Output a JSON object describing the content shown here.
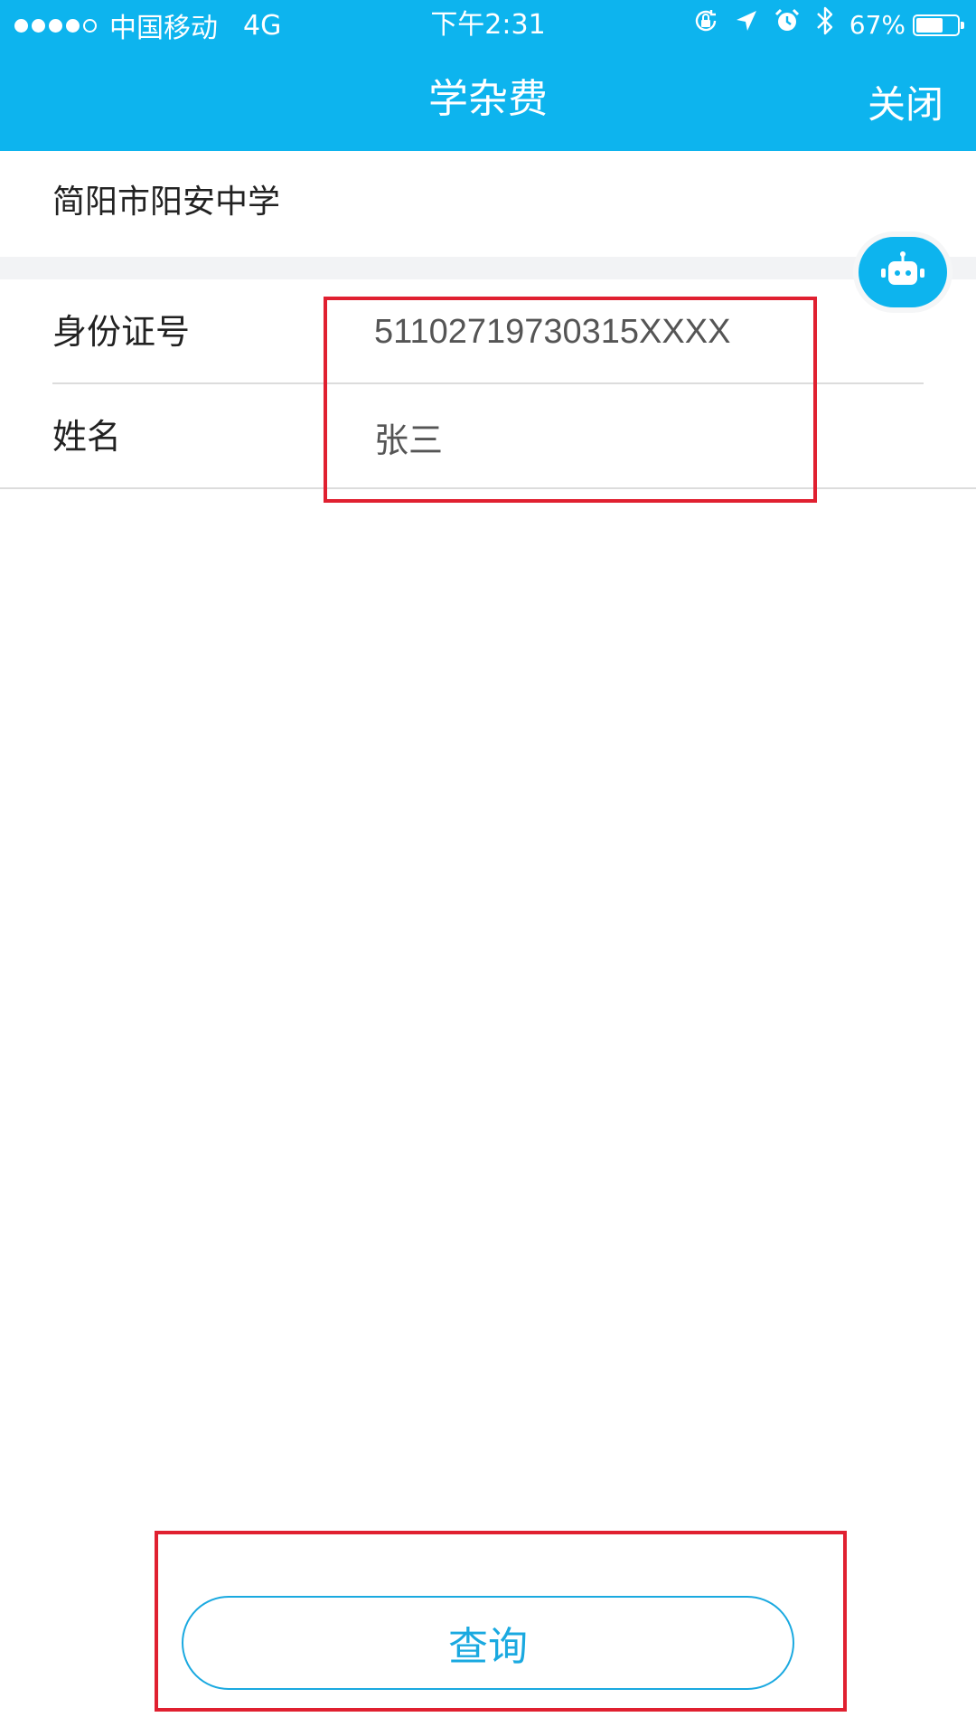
{
  "status_bar": {
    "carrier": "中国移动",
    "network": "4G",
    "time": "下午2:31",
    "battery_text": "67%",
    "battery_level": 0.67,
    "icons": [
      "rotation-lock-icon",
      "location-arrow-icon",
      "alarm-icon",
      "bluetooth-icon"
    ]
  },
  "nav": {
    "title": "学杂费",
    "close_label": "关闭"
  },
  "school": {
    "name": "简阳市阳安中学"
  },
  "assistant": {
    "icon": "robot-icon"
  },
  "form": {
    "id_label": "身份证号",
    "id_value": "51102719730315XXXX",
    "name_label": "姓名",
    "name_value": "张三"
  },
  "actions": {
    "query_label": "查询"
  },
  "colors": {
    "header_bg": "#0db4ee",
    "accent": "#1aa9e0",
    "highlight_box": "#e02030",
    "separator": "#dcdcdc"
  }
}
